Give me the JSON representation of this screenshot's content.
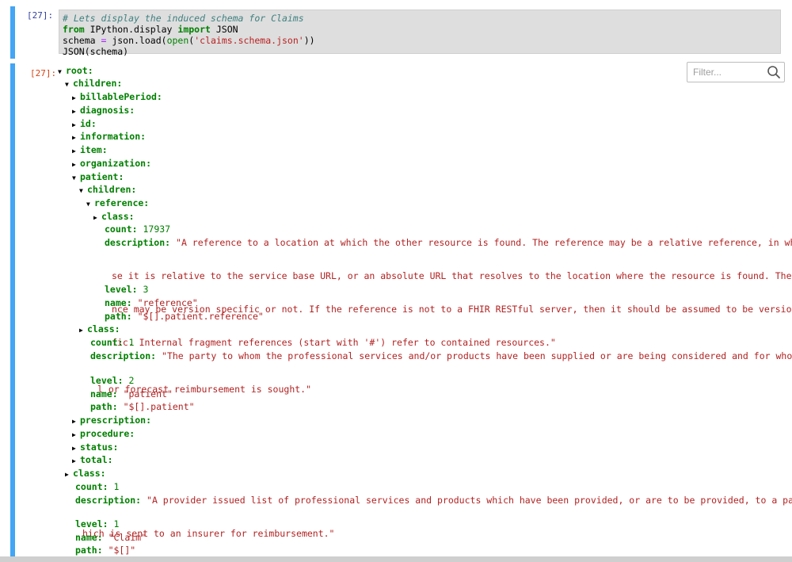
{
  "input_cell": {
    "prompt": "[27]:",
    "lines": [
      {
        "comment": "# Lets display the induced schema for Claims"
      },
      {
        "kw1": "from",
        "t1": " IPython.display ",
        "kw2": "import",
        "t2": " JSON"
      },
      {
        "t1": "schema ",
        "op": "=",
        "t2": " json.load(",
        "fn": "open",
        "t3": "(",
        "str": "'claims.schema.json'",
        "t4": "))"
      },
      {
        "t1": "JSON(schema)"
      }
    ]
  },
  "output_cell": {
    "prompt": "[27]:",
    "filter_placeholder": "Filter...",
    "tree": {
      "root": "root:",
      "children": "children:",
      "billablePeriod": "billablePeriod:",
      "diagnosis": "diagnosis:",
      "id": "id:",
      "information": "information:",
      "item": "item:",
      "organization": "organization:",
      "patient": "patient:",
      "patient_children": "children:",
      "reference": "reference:",
      "reference_class": "class:",
      "reference_count_key": "count:",
      "reference_count_val": "17937",
      "reference_desc_key": "description:",
      "reference_desc_lines": [
        "\"A reference to a location at which the other resource is found. The reference may be a relative reference, in which ca",
        "se it is relative to the service base URL, or an absolute URL that resolves to the location where the resource is found. The refere",
        "nce may be version specific or not. If the reference is not to a FHIR RESTful server, then it should be assumed to be version speci",
        "fic. Internal fragment references (start with '#') refer to contained resources.\""
      ],
      "reference_level_key": "level:",
      "reference_level_val": "3",
      "reference_name_key": "name:",
      "reference_name_val": "\"reference\"",
      "reference_path_key": "path:",
      "reference_path_val": "\"$[].patient.reference\"",
      "patient_class": "class:",
      "patient_count_key": "count:",
      "patient_count_val": "1",
      "patient_desc_key": "description:",
      "patient_desc_lines": [
        "\"The party to whom the professional services and/or products have been supplied or are being considered and for whom actua",
        "l or forecast reimbursement is sought.\""
      ],
      "patient_level_key": "level:",
      "patient_level_val": "2",
      "patient_name_key": "name:",
      "patient_name_val": "\"patient\"",
      "patient_path_key": "path:",
      "patient_path_val": "\"$[].patient\"",
      "prescription": "prescription:",
      "procedure": "procedure:",
      "status": "status:",
      "total": "total:",
      "root_class": "class:",
      "root_count_key": "count:",
      "root_count_val": "1",
      "root_desc_key": "description:",
      "root_desc_lines": [
        "\"A provider issued list of professional services and products which have been provided, or are to be provided, to a patient w",
        "hich is sent to an insurer for reimbursement.\""
      ],
      "root_level_key": "level:",
      "root_level_val": "1",
      "root_name_key": "name:",
      "root_name_val": "\"Claim\"",
      "root_path_key": "path:",
      "root_path_val": "\"$[]\""
    }
  }
}
